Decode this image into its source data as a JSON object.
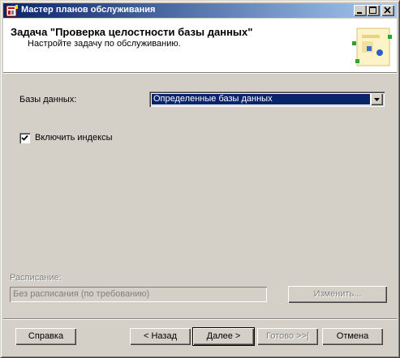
{
  "window": {
    "title": "Мастер планов обслуживания"
  },
  "header": {
    "title": "Задача \"Проверка целостности базы данных\"",
    "subtitle": "Настройте задачу по обслуживанию."
  },
  "form": {
    "databases_label": "Базы данных:",
    "databases_value": "Определенные базы данных",
    "include_indexes_label": "Включить индексы",
    "include_indexes_checked": true,
    "schedule_label": "Расписание:",
    "schedule_value": "Без расписания (по требованию)",
    "change_button": "Изменить..."
  },
  "buttons": {
    "help": "Справка",
    "back": "< Назад",
    "next": "Далее >",
    "finish": "Готово >>|",
    "cancel": "Отмена"
  },
  "colors": {
    "title_start": "#0a246a",
    "title_end": "#a6caf0",
    "face": "#d4d0c8",
    "selection": "#0a246a"
  }
}
